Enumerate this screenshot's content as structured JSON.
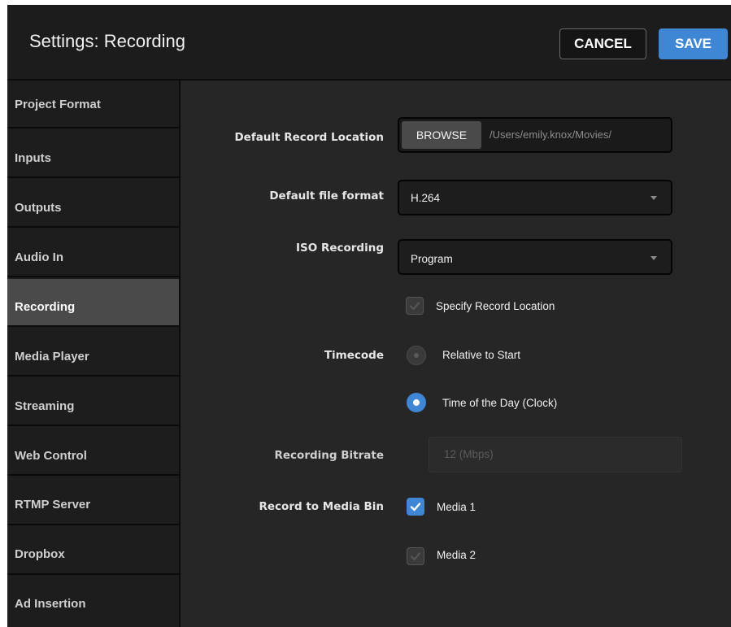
{
  "header": {
    "title": "Settings: Recording",
    "cancel_label": "CANCEL",
    "save_label": "SAVE"
  },
  "sidebar": {
    "items": [
      {
        "label": "Project Format",
        "active": false
      },
      {
        "label": "Inputs",
        "active": false
      },
      {
        "label": "Outputs",
        "active": false
      },
      {
        "label": "Audio In",
        "active": false
      },
      {
        "label": "Recording",
        "active": true
      },
      {
        "label": "Media Player",
        "active": false
      },
      {
        "label": "Streaming",
        "active": false
      },
      {
        "label": "Web Control",
        "active": false
      },
      {
        "label": "RTMP Server",
        "active": false
      },
      {
        "label": "Dropbox",
        "active": false
      },
      {
        "label": "Ad Insertion",
        "active": false
      }
    ]
  },
  "form": {
    "record_location": {
      "label": "Default Record Location",
      "browse_label": "BROWSE",
      "path": "/Users/emily.knox/Movies/"
    },
    "file_format": {
      "label": "Default file format",
      "value": "H.264"
    },
    "iso_recording": {
      "label": "ISO Recording",
      "value": "Program"
    },
    "specify_location": {
      "label": "Specify Record Location",
      "checked": true,
      "enabled": false
    },
    "timecode": {
      "label": "Timecode",
      "options": [
        {
          "label": "Relative to Start",
          "selected": false
        },
        {
          "label": "Time of the Day (Clock)",
          "selected": true
        }
      ]
    },
    "bitrate": {
      "label": "Recording Bitrate",
      "value": "12 (Mbps)"
    },
    "media_bin": {
      "label": "Record to Media Bin",
      "options": [
        {
          "label": "Media 1",
          "checked": true,
          "enabled": true
        },
        {
          "label": "Media 2",
          "checked": true,
          "enabled": false
        }
      ]
    }
  },
  "colors": {
    "accent": "#3f86d4",
    "panel": "#262626",
    "sidebar": "#1d1d1d",
    "active_item": "#4a4a4a"
  }
}
